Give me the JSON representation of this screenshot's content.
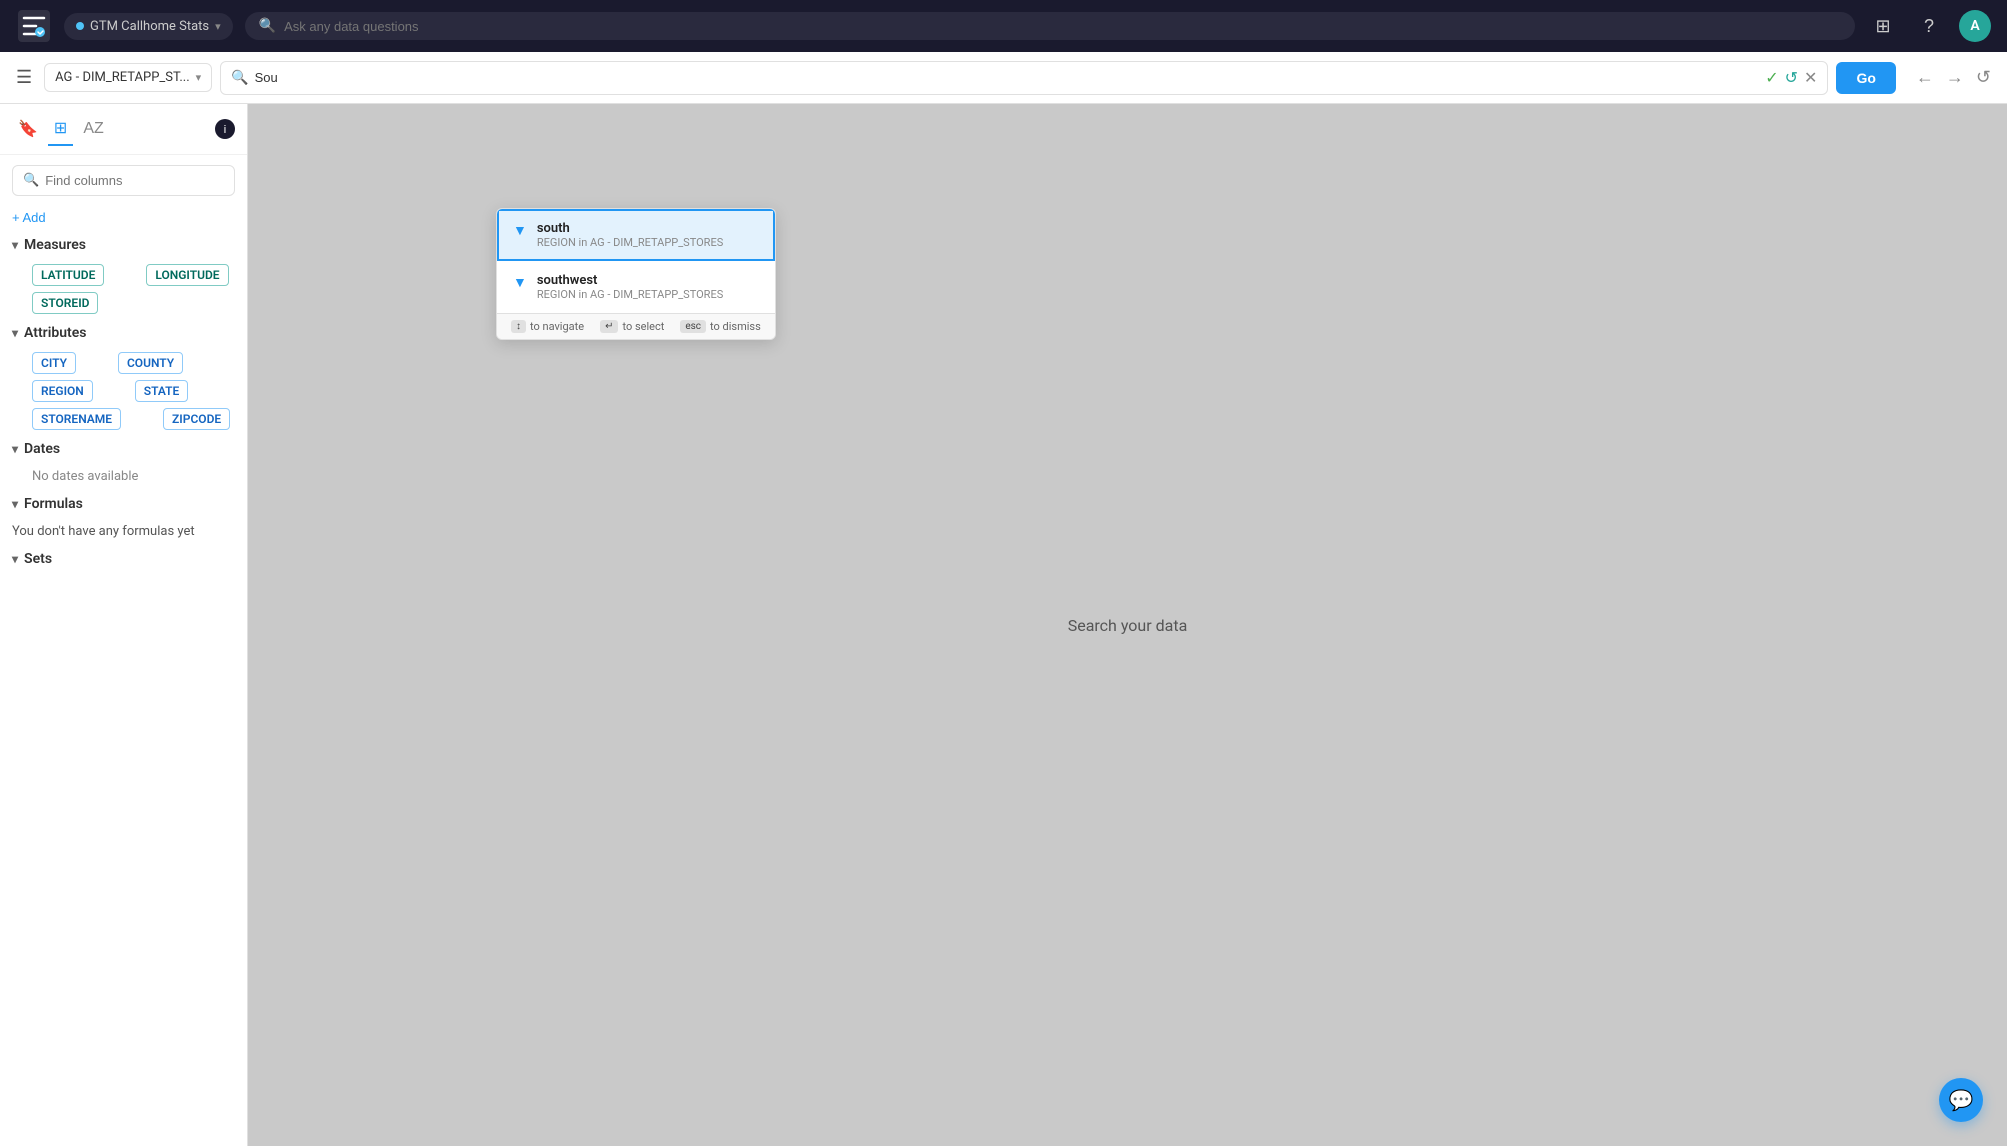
{
  "topNav": {
    "datasource": "GTM Callhome Stats",
    "searchPlaceholder": "Ask any data questions",
    "avatarInitial": "A"
  },
  "secondBar": {
    "datasourceLabel": "AG - DIM_RETAPP_ST...",
    "searchValue": "Sou",
    "searchPlaceholder": "",
    "goLabel": "Go"
  },
  "sidebar": {
    "findColumnsPlaceholder": "Find columns",
    "addLabel": "+ Add",
    "infoLabel": "i",
    "measures": {
      "label": "Measures",
      "items": [
        "LATITUDE",
        "LONGITUDE",
        "STOREID"
      ]
    },
    "attributes": {
      "label": "Attributes",
      "items": [
        "CITY",
        "COUNTY",
        "REGION",
        "STATE",
        "STORENAME",
        "ZIPCODE"
      ]
    },
    "dates": {
      "label": "Dates",
      "emptyText": "No dates available"
    },
    "formulas": {
      "label": "Formulas",
      "emptyText": "You don't have any formulas yet"
    },
    "sets": {
      "label": "Sets"
    }
  },
  "dropdown": {
    "items": [
      {
        "name": "south",
        "sub": "REGION in AG - DIM_RETAPP_STORES",
        "selected": true
      },
      {
        "name": "southwest",
        "sub": "REGION in AG - DIM_RETAPP_STORES",
        "selected": false
      }
    ],
    "footer": {
      "navigate": "to navigate",
      "select": "to select",
      "dismiss": "to dismiss",
      "navKey": "↕",
      "selectKey": "↵",
      "dismissKey": "esc"
    }
  },
  "mainContent": {
    "emptyText": "Search your data"
  }
}
